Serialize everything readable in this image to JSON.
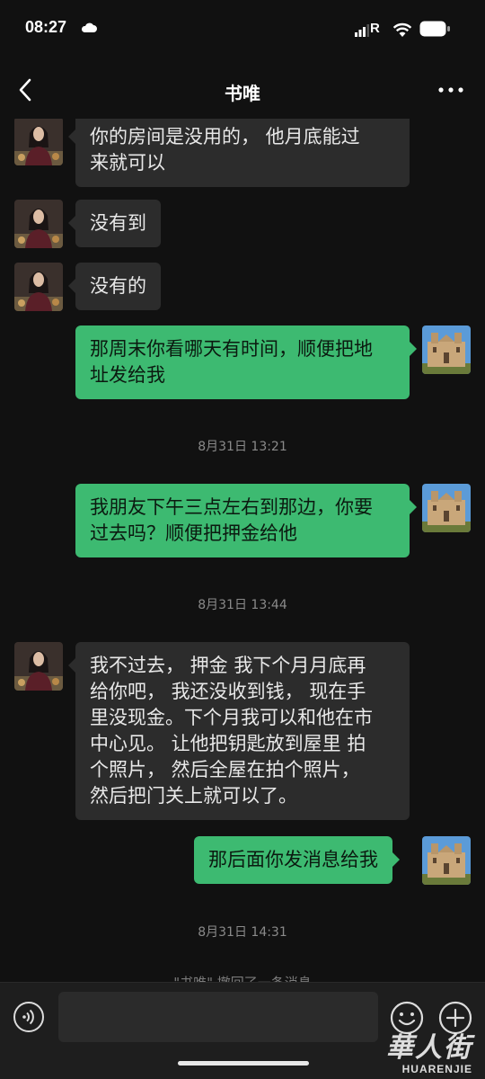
{
  "status_bar": {
    "time": "08:27",
    "carrier": "R",
    "icons": [
      "cloud-icon",
      "signal-icon",
      "wifi-icon",
      "battery-icon"
    ]
  },
  "header": {
    "title": "书唯",
    "back_icon": "chevron-left-icon",
    "more_icon": "more-dots-icon"
  },
  "messages": [
    {
      "sender": "contact",
      "text_lines": [
        "你的房间是没用的， 他月底能过",
        "来就可以"
      ]
    },
    {
      "sender": "contact",
      "text_lines": [
        "没有到"
      ]
    },
    {
      "sender": "contact",
      "text_lines": [
        "没有的"
      ]
    },
    {
      "sender": "me",
      "text_lines": [
        "那周末你看哪天有时间，顺便把地",
        "址发给我"
      ]
    },
    {
      "timestamp": "8月31日 13:21"
    },
    {
      "sender": "me",
      "text_lines": [
        "我朋友下午三点左右到那边，你要",
        "过去吗？顺便把押金给他"
      ]
    },
    {
      "timestamp": "8月31日 13:44"
    },
    {
      "sender": "contact",
      "text_lines": [
        "我不过去， 押金 我下个月月底再",
        "给你吧， 我还没收到钱， 现在手",
        "里没现金。下个月我可以和他在市",
        "中心见。 让他把钥匙放到屋里 拍",
        "个照片， 然后全屋在拍个照片，",
        "然后把门关上就可以了。"
      ]
    },
    {
      "sender": "me",
      "text_lines": [
        "那后面你发消息给我"
      ]
    },
    {
      "timestamp": "8月31日 14:31"
    },
    {
      "system": "\"书唯\" 撤回了一条消息"
    }
  ],
  "input_bar": {
    "voice_icon": "voice-icon",
    "emoji_icon": "emoji-icon",
    "plus_icon": "plus-icon"
  },
  "watermark": {
    "main": "華人街",
    "sub": "HUARENJIE"
  },
  "colors": {
    "background": "#111111",
    "bubble_in": "#2c2c2c",
    "bubble_out": "#3dba71",
    "input_bar": "#1e1e1e"
  }
}
